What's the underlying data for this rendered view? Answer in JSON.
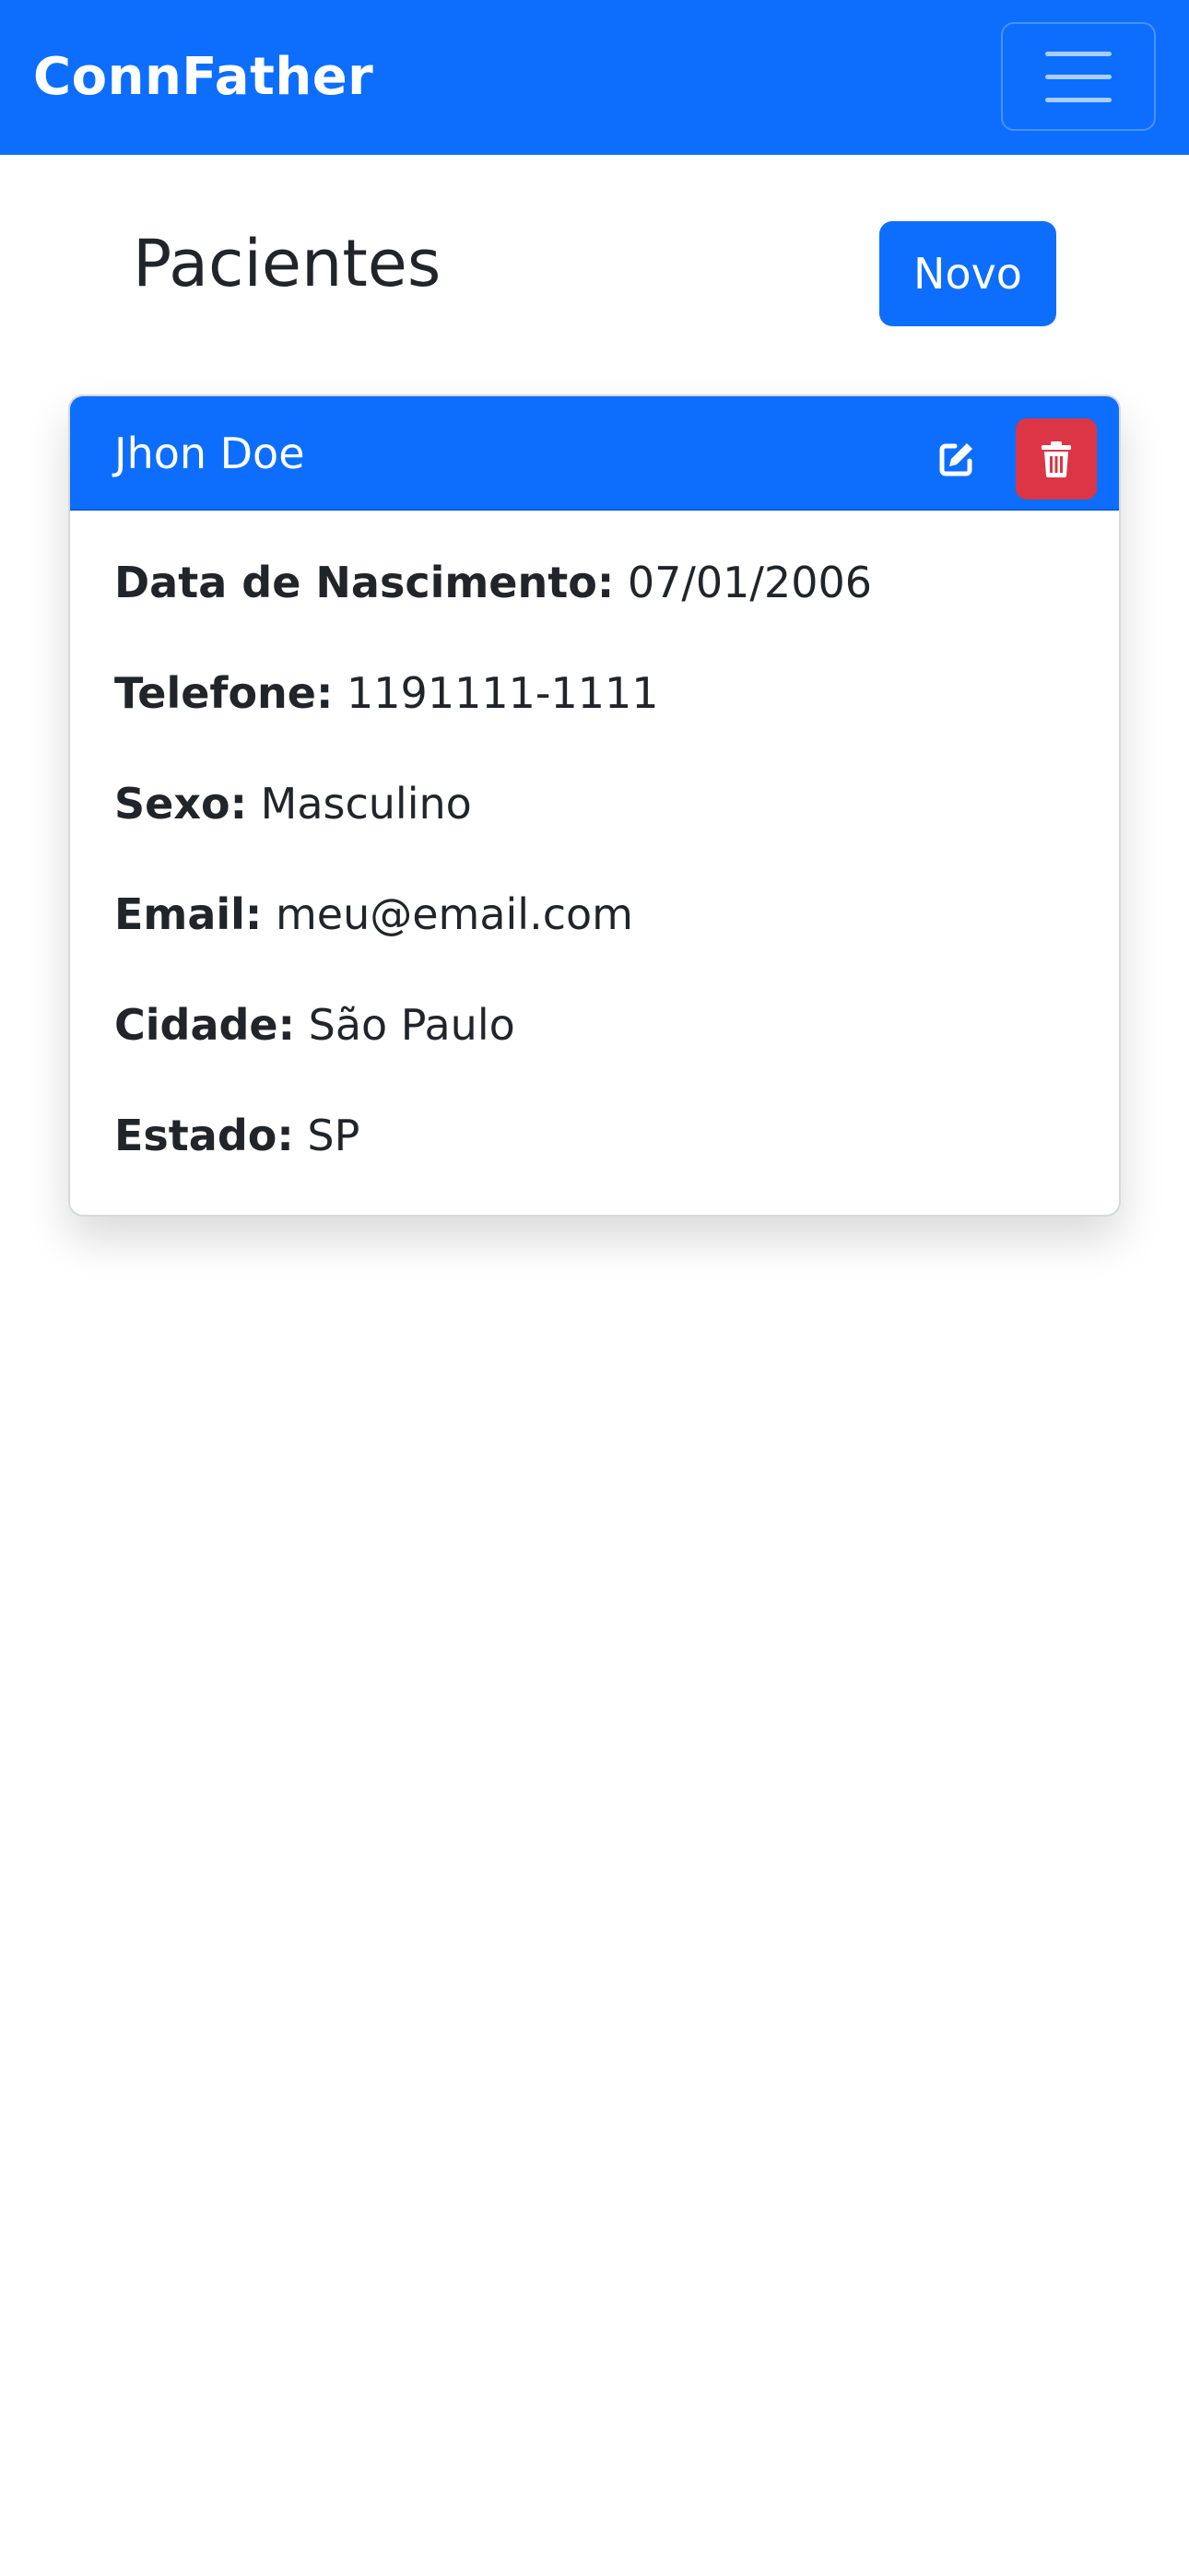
{
  "navbar": {
    "brand": "ConnFather"
  },
  "page": {
    "title": "Pacientes",
    "new_button": "Novo"
  },
  "patient": {
    "name": "Jhon Doe",
    "fields": [
      {
        "label": "Data de Nascimento:",
        "value": "07/01/2006"
      },
      {
        "label": "Telefone:",
        "value": "1191111-1111"
      },
      {
        "label": "Sexo:",
        "value": "Masculino"
      },
      {
        "label": "Email:",
        "value": "meu@email.com"
      },
      {
        "label": "Cidade:",
        "value": "São Paulo"
      },
      {
        "label": "Estado:",
        "value": "SP"
      }
    ]
  },
  "icons": {
    "menu": "hamburger-icon",
    "edit": "edit-icon",
    "delete": "trash-icon"
  },
  "colors": {
    "primary": "#0d6efd",
    "danger": "#dc3545",
    "text": "#212529"
  }
}
